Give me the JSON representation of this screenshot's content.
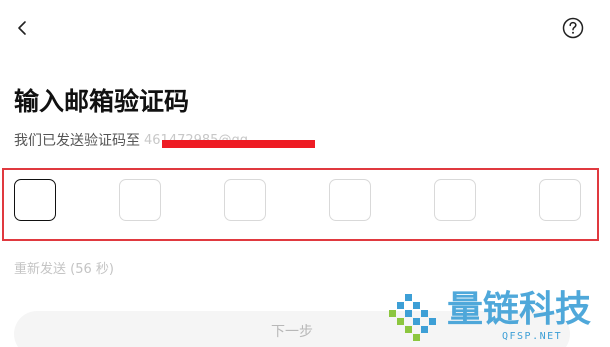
{
  "header": {
    "back_icon": "chevron-left-icon",
    "help_icon": "question-circle-icon"
  },
  "title": "输入邮箱验证码",
  "subtitle": {
    "text": "我们已发送验证码至",
    "email_masked": "461472985@qq"
  },
  "code_inputs": {
    "count": 6,
    "values": [
      "",
      "",
      "",
      "",
      "",
      ""
    ],
    "active_index": 0
  },
  "resend_label": "重新发送 (56 秒)",
  "next_button_label": "下一步",
  "watermark": {
    "title": "量链科技",
    "subtitle": "QFSP.NET"
  },
  "colors": {
    "annotation_red": "#e0393f",
    "watermark_blue": "#3d9fd6",
    "watermark_green": "#8cc63f",
    "disabled_text": "#c4c4c4"
  }
}
